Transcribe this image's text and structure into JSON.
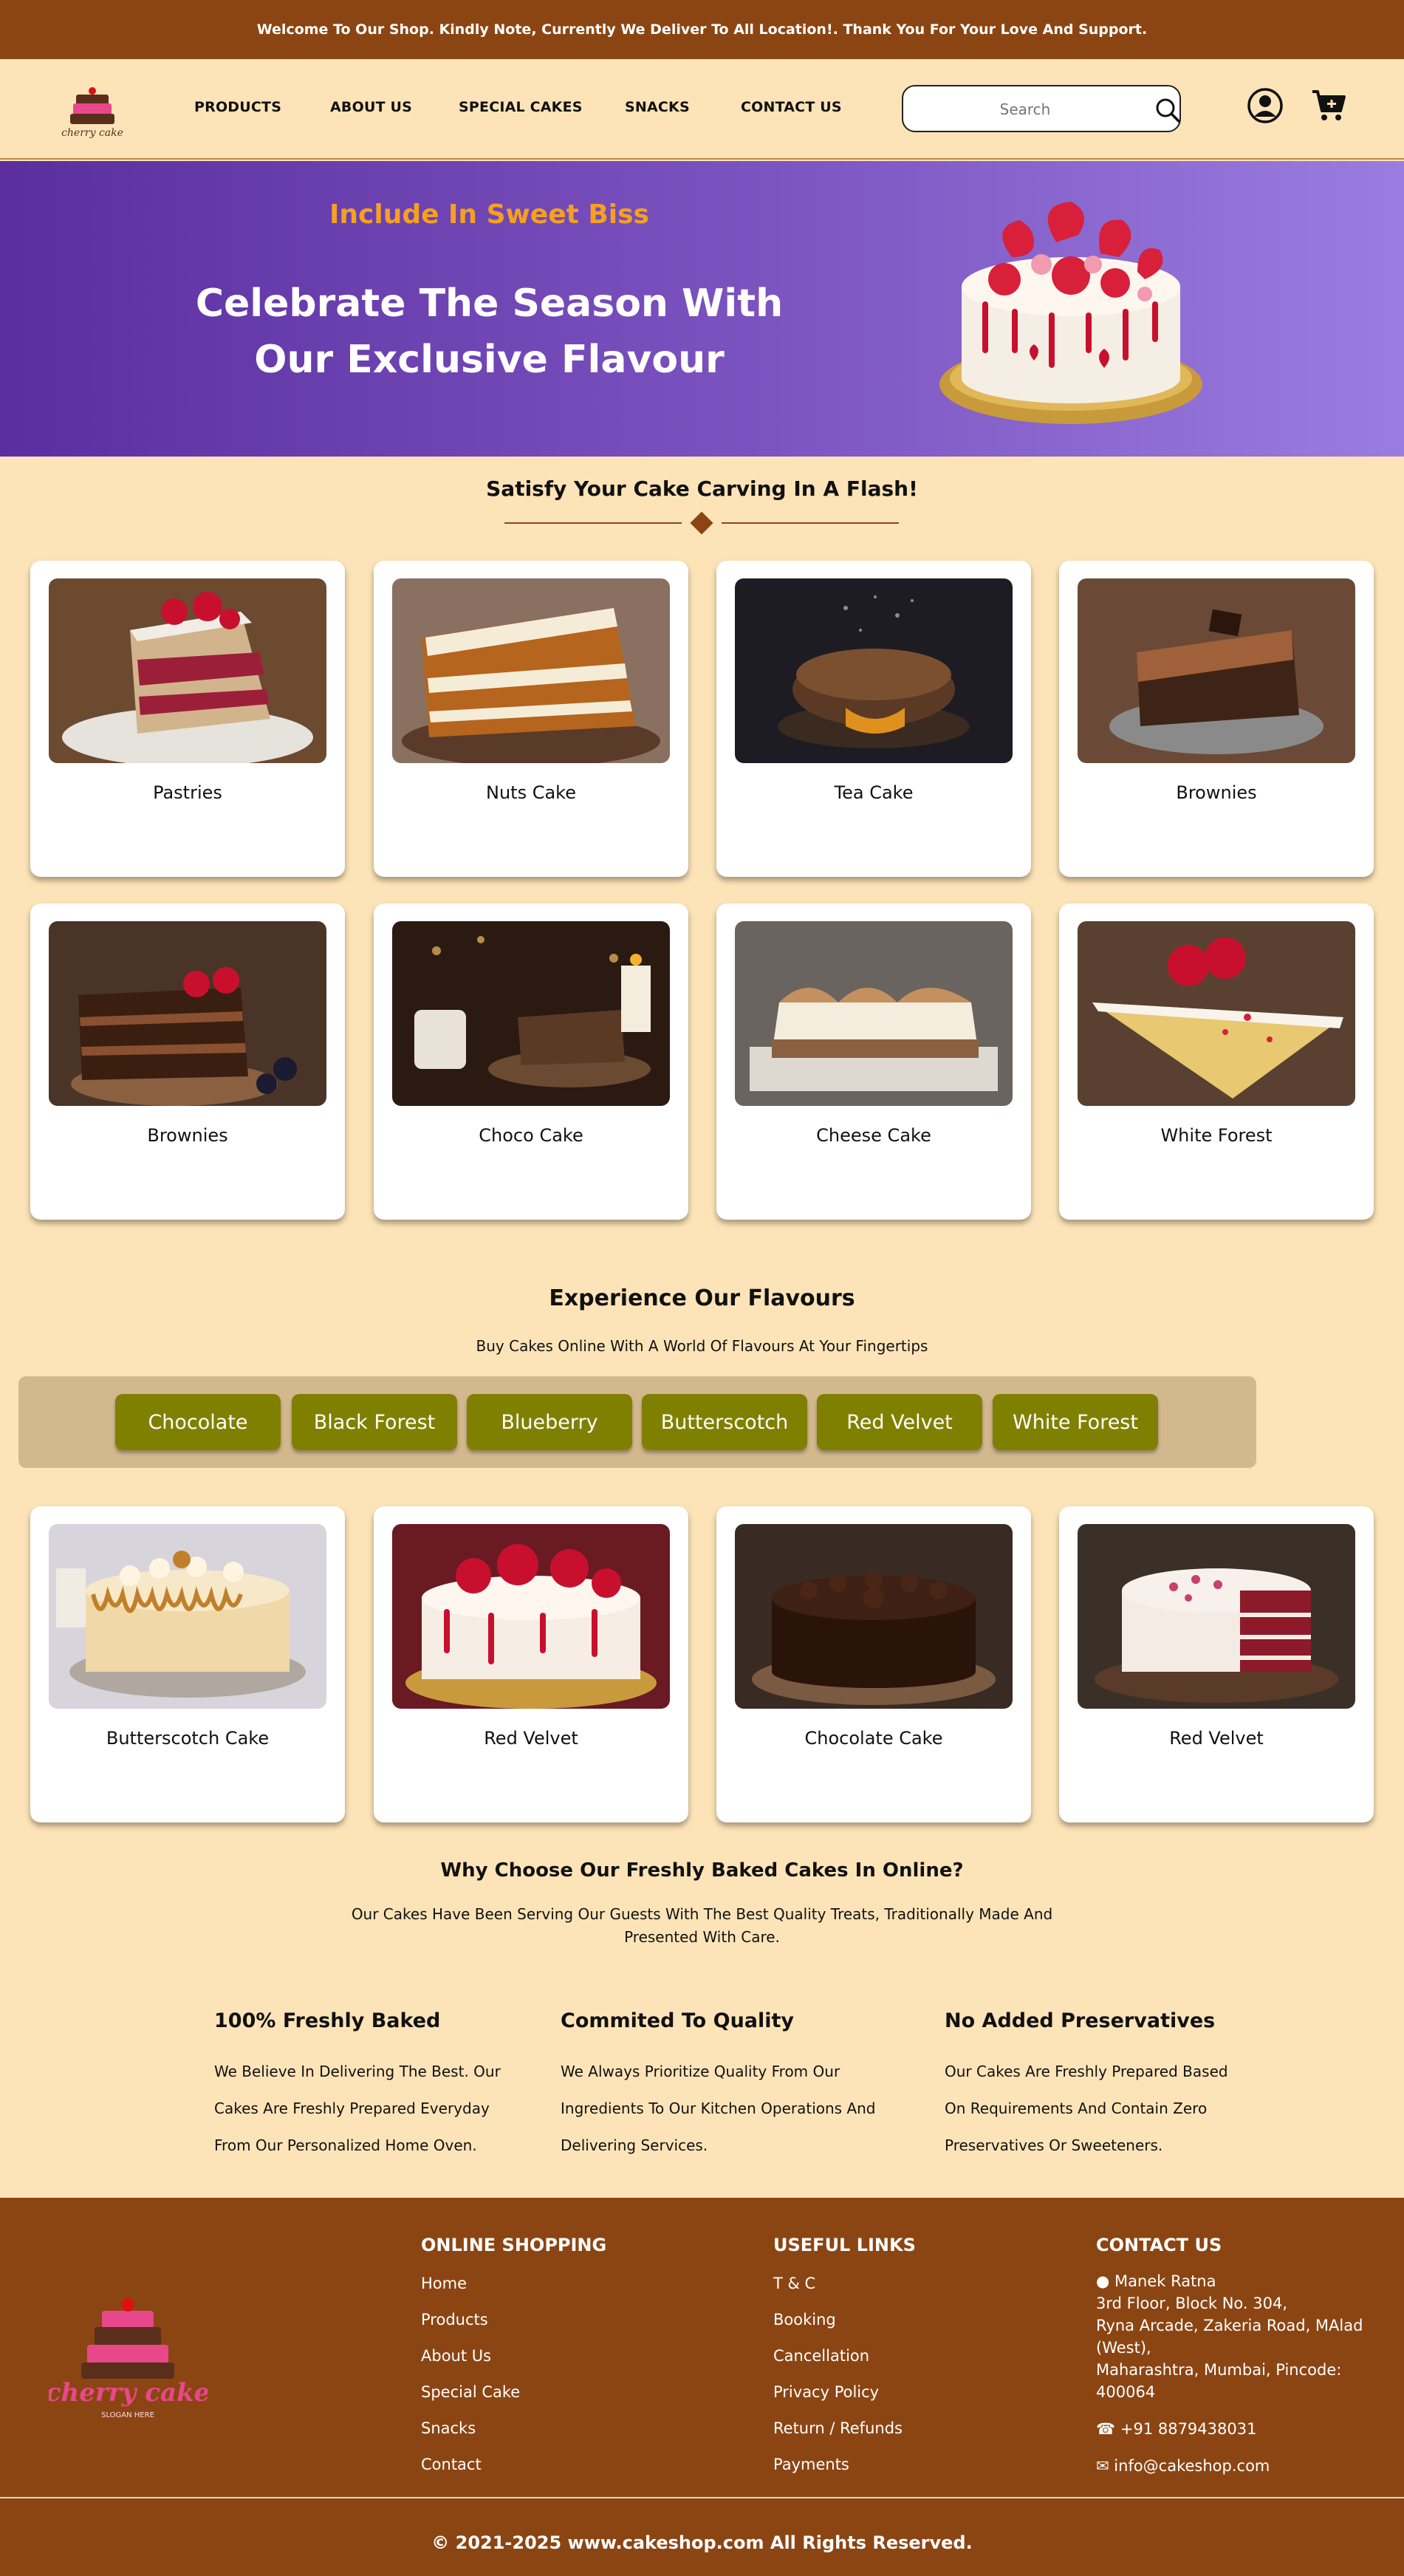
{
  "announcement": "Welcome To Our Shop. Kindly Note, Currently We Deliver To All Location!. Thank You For Your Love And Support.",
  "header": {
    "logo_text": "cherry cake",
    "nav": [
      "PRODUCTS",
      "ABOUT US",
      "SPECIAL CAKES",
      "SNACKS",
      "CONTACT US"
    ],
    "search_placeholder": "Search",
    "icons": [
      "search-icon",
      "user-icon",
      "cart-icon"
    ]
  },
  "hero": {
    "kicker": "Include In Sweet Biss",
    "title": "Celebrate The Season With Our Exclusive Flavour"
  },
  "categories": {
    "title": "Satisfy Your Cake Carving In A Flash!",
    "items": [
      "Pastries",
      "Nuts Cake",
      "Tea Cake",
      "Brownies",
      "Brownies",
      "Choco Cake",
      "Cheese Cake",
      "White Forest"
    ]
  },
  "flavours": {
    "title": "Experience Our Flavours",
    "subtitle": "Buy Cakes Online With A World Of Flavours At Your Fingertips",
    "tabs": [
      "Chocolate",
      "Black Forest",
      "Blueberry",
      "Butterscotch",
      "Red Velvet",
      "White Forest"
    ],
    "items": [
      "Butterscotch Cake",
      "Red Velvet",
      "Chocolate Cake",
      "Red Velvet"
    ]
  },
  "why": {
    "title": "Why Choose Our Freshly Baked Cakes In Online?",
    "subtitle": "Our Cakes Have Been Serving Our Guests With The Best Quality Treats, Traditionally Made And Presented With Care.",
    "columns": [
      {
        "head": "100% Freshly Baked",
        "text": "We Believe In Delivering The Best. Our Cakes Are Freshly Prepared Everyday From Our Personalized Home Oven."
      },
      {
        "head": "Commited To Quality",
        "text": "We Always Prioritize Quality From Our Ingredients To Our Kitchen Operations And Delivering Services."
      },
      {
        "head": "No Added Preservatives",
        "text": "Our Cakes Are Freshly Prepared Based On Requirements And Contain Zero Preservatives Or Sweeteners."
      }
    ]
  },
  "footer": {
    "logo_text": "cherry cake",
    "logo_slogan": "SLOGAN HERE",
    "shopping": {
      "head": "ONLINE SHOPPING",
      "links": [
        "Home",
        "Products",
        "About Us",
        "Special Cake",
        "Snacks",
        "Contact"
      ]
    },
    "useful": {
      "head": "USEFUL LINKS",
      "links": [
        "T & C",
        "Booking",
        "Cancellation",
        "Privacy Policy",
        "Return / Refunds",
        "Payments"
      ]
    },
    "contact": {
      "head": "CONTACT US",
      "name": "Manek Ratna",
      "address1": "3rd Floor, Block No. 304,",
      "address2": "Ryna Arcade, Zakeria Road, MAlad (West),",
      "address3": "Maharashtra, Mumbai, Pincode: 400064",
      "phone": "+91 8879438031",
      "email": "info@cakeshop.com"
    },
    "copyright": "© 2021-2025 www.cakeshop.com All Rights Reserved."
  },
  "colors": {
    "brown": "#8b4513",
    "cream": "#fde4b8",
    "olive": "#808000",
    "hero_purple": "#5b2ea0",
    "accent_orange": "#f5a020"
  }
}
